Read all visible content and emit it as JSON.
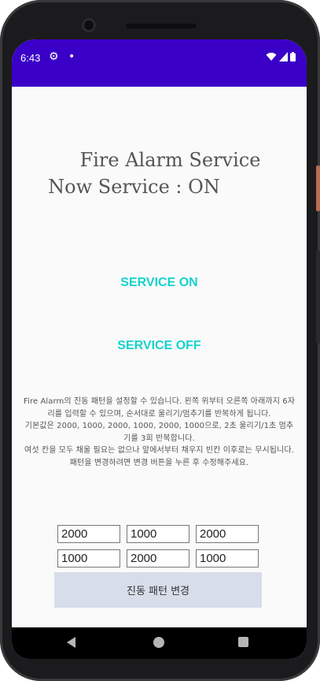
{
  "status_bar": {
    "time": "6:43",
    "icons": [
      "gear-icon",
      "dot-icon",
      "wifi-icon",
      "signal-icon",
      "battery-icon"
    ],
    "color": "#3a00c8"
  },
  "header": {
    "title_line1": "Fire Alarm Service",
    "title_line2": "Now Service : ON"
  },
  "buttons": {
    "service_on": "SERVICE ON",
    "service_off": "SERVICE OFF",
    "accent_color": "#14d3cd",
    "change_pattern": "진동 패턴 변경"
  },
  "description": {
    "line1": "Fire Alarm의 진동 패턴을 설정할 수 있습니다. 왼쪽 위부터 오른쪽 아래까지 6자리를 입력할 수 있으며, 순서대로 울리기/멈추기를 반복하게 됩니다.",
    "line2": "기본값은 2000, 1000, 2000, 1000, 2000, 1000으로, 2초 울리기/1초 멈추기를 3회 반복합니다.",
    "line3": "여섯 칸을 모두 채울 필요는 없으나 앞에서부터 채우지 빈칸 이후로는 무시됩니다.",
    "line4": "패턴을 변경하려면 변경 버튼을 누른 후 수정해주세요."
  },
  "pattern_inputs": [
    "2000",
    "1000",
    "2000",
    "1000",
    "2000",
    "1000"
  ]
}
